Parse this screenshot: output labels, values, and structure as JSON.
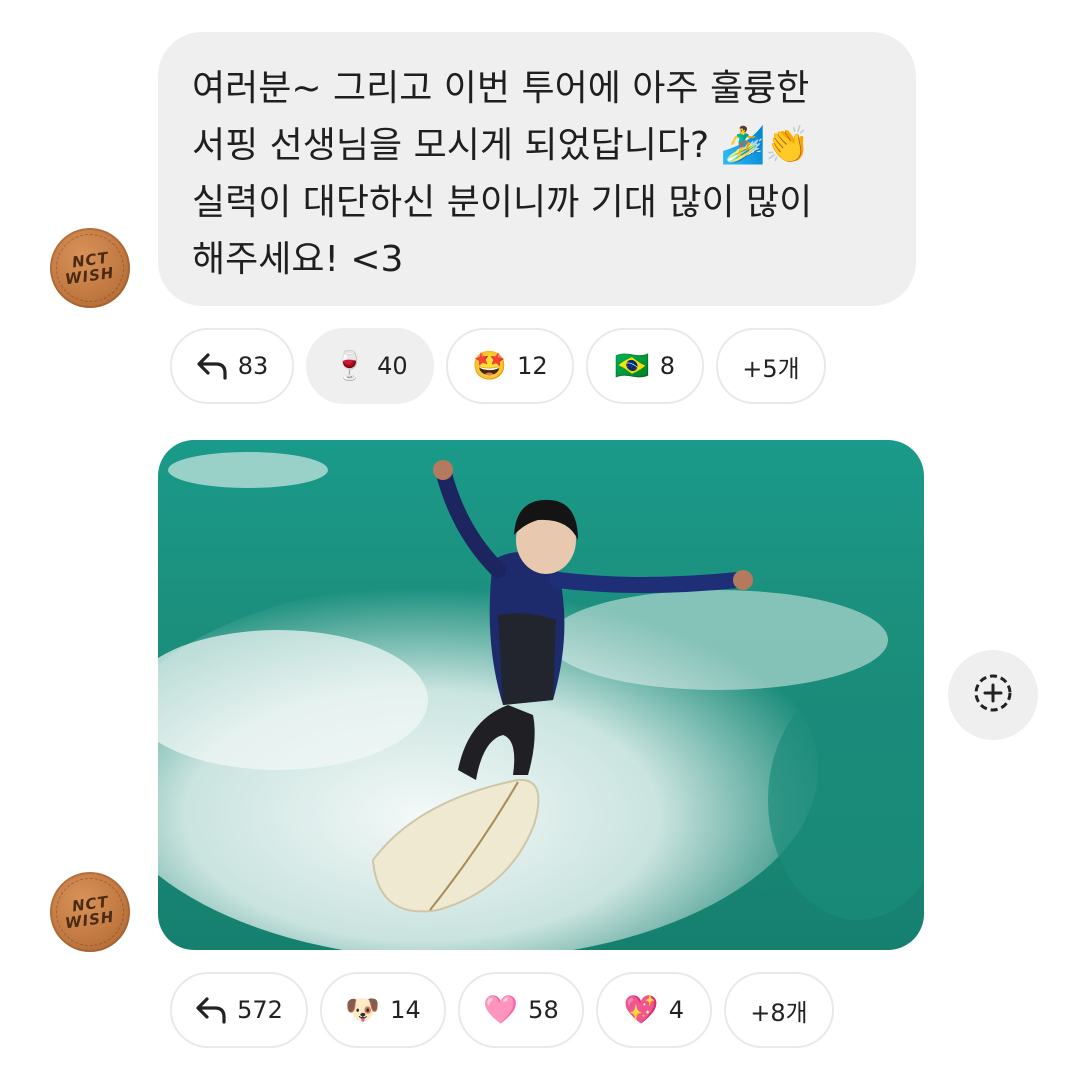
{
  "messages": [
    {
      "avatar_text": [
        "NCT",
        "WISH"
      ],
      "text_lines": [
        "여러분~ 그리고 이번 투어에 아주 훌륭한",
        "서핑 선생님을 모시게 되었답니다? 🏄‍♂️👏",
        "실력이 대단하신 분이니까 기대 많이 많이",
        "해주세요! <3"
      ],
      "reactions": {
        "reply_count": "83",
        "items": [
          {
            "emoji": "🍷",
            "count": "40",
            "active": true
          },
          {
            "emoji": "🤩",
            "count": "12",
            "active": false
          },
          {
            "emoji": "🇧🇷",
            "count": "8",
            "active": false
          }
        ],
        "more": "+5개"
      }
    },
    {
      "avatar_text": [
        "NCT",
        "WISH"
      ],
      "image_description_icon": "surfer-photo",
      "reactions": {
        "reply_count": "572",
        "items": [
          {
            "emoji": "🐶",
            "count": "14",
            "active": false
          },
          {
            "emoji": "🩷",
            "count": "58",
            "active": false
          },
          {
            "emoji": "💖",
            "count": "4",
            "active": false
          }
        ],
        "more": "+8개"
      }
    }
  ],
  "colors": {
    "bubble_bg": "#efefef",
    "chip_border": "#e9e9e9",
    "avatar": "#c27a42"
  },
  "icons": {
    "reply": "reply-arrow-icon",
    "add_reaction": "add-reaction-icon"
  }
}
